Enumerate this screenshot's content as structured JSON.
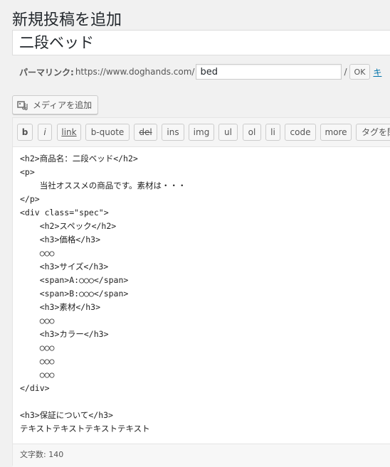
{
  "page": {
    "heading": "新規投稿を追加"
  },
  "post": {
    "title": "二段ベッド"
  },
  "permalink": {
    "label": "パーマリンク:",
    "base_url": "https://www.doghands.com/",
    "slug": "bed",
    "slash": "/",
    "ok_label": "OK",
    "cancel_label": "キ"
  },
  "media_button": {
    "label": "メディアを追加",
    "icon": "media-icon"
  },
  "quicktags": [
    {
      "label": "b"
    },
    {
      "label": "i"
    },
    {
      "label": "link"
    },
    {
      "label": "b-quote"
    },
    {
      "label": "del"
    },
    {
      "label": "ins"
    },
    {
      "label": "img"
    },
    {
      "label": "ul"
    },
    {
      "label": "ol"
    },
    {
      "label": "li"
    },
    {
      "label": "code"
    },
    {
      "label": "more"
    },
    {
      "label": "タグを閉"
    }
  ],
  "editor": {
    "lines": [
      "<h2>商品名：二段ベッド</h2>",
      "<p>",
      "    当社オススメの商品です。素材は・・・",
      "</p>",
      "<div class=\"spec\">",
      "    <h2>スペック</h2>",
      "    <h3>価格</h3>",
      "    ○○○",
      "    <h3>サイズ</h3>",
      "    <span>A:○○○</span>",
      "    <span>B:○○○</span>",
      "    <h3>素材</h3>",
      "    ○○○",
      "    <h3>カラー</h3>",
      "    ○○○",
      "    ○○○",
      "    ○○○",
      "</div>",
      "",
      "<h3>保証について</h3>",
      "テキストテキストテキストテキスト"
    ]
  },
  "status": {
    "wordcount": "文字数: 140"
  },
  "colors": {
    "link": "#0073aa",
    "background": "#f1f1f1"
  }
}
